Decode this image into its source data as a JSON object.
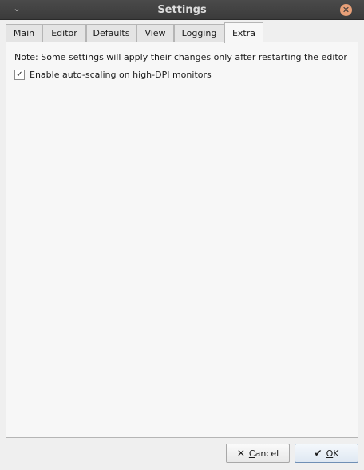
{
  "window": {
    "title": "Settings",
    "menu_icon": "chevron-down-icon",
    "close_icon": "close-icon",
    "close_color": "#e8a078"
  },
  "tabs": [
    {
      "label": "Main"
    },
    {
      "label": "Editor"
    },
    {
      "label": "Defaults"
    },
    {
      "label": "View"
    },
    {
      "label": "Logging"
    },
    {
      "label": "Extra",
      "active": true
    }
  ],
  "extra": {
    "note": "Note: Some settings will apply their changes only after restarting the editor",
    "autoscale": {
      "label": "Enable auto-scaling on high-DPI monitors",
      "checked": true
    }
  },
  "buttons": {
    "cancel": {
      "mnemonic": "C",
      "rest": "ancel",
      "icon": "x-icon"
    },
    "ok": {
      "mnemonic": "O",
      "rest": "K",
      "icon": "checkmark-icon"
    }
  }
}
